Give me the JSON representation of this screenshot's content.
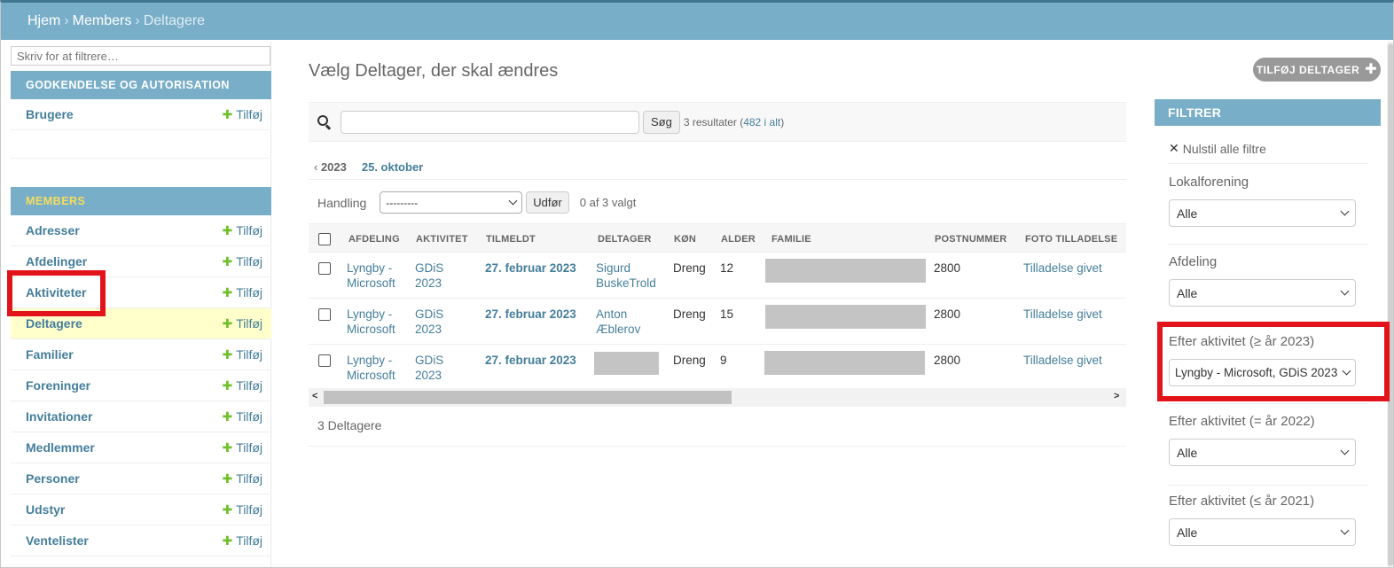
{
  "breadcrumb": {
    "home": "Hjem",
    "app": "Members",
    "current": "Deltagere",
    "separator": "›"
  },
  "sidebar": {
    "filter_placeholder": "Skriv for at filtrere…",
    "sections": [
      {
        "caption": "GODKENDELSE OG AUTORISATION",
        "items": [
          {
            "label": "Brugere",
            "add": "Tilføj"
          }
        ]
      },
      {
        "caption": "MEMBERS",
        "items": [
          {
            "label": "Adresser",
            "add": "Tilføj"
          },
          {
            "label": "Afdelinger",
            "add": "Tilføj"
          },
          {
            "label": "Aktiviteter",
            "add": "Tilføj"
          },
          {
            "label": "Deltagere",
            "add": "Tilføj",
            "selected": true
          },
          {
            "label": "Familier",
            "add": "Tilføj"
          },
          {
            "label": "Foreninger",
            "add": "Tilføj"
          },
          {
            "label": "Invitationer",
            "add": "Tilføj"
          },
          {
            "label": "Medlemmer",
            "add": "Tilføj"
          },
          {
            "label": "Personer",
            "add": "Tilføj"
          },
          {
            "label": "Udstyr",
            "add": "Tilføj"
          },
          {
            "label": "Ventelister",
            "add": "Tilføj"
          }
        ]
      }
    ]
  },
  "main": {
    "title": "Vælg Deltager, der skal ændres",
    "add_button": "TILFØJ DELTAGER",
    "search": {
      "button": "Søg",
      "result_prefix": "3 resultater (",
      "result_link": "482 i alt",
      "result_suffix": ")"
    },
    "date_nav": {
      "back_year": "2023",
      "day": "25. oktober"
    },
    "actions": {
      "label": "Handling",
      "select_value": "---------",
      "run": "Udfør",
      "selected_count": "0 af 3 valgt"
    },
    "columns": [
      "AFDELING",
      "AKTIVITET",
      "TILMELDT",
      "DELTAGER",
      "KØN",
      "ALDER",
      "FAMILIE",
      "POSTNUMMER",
      "FOTO TILLADELSE"
    ],
    "rows": [
      {
        "afdeling": [
          "Lyngby -",
          "Microsoft"
        ],
        "aktivitet": [
          "GDiS",
          "2023"
        ],
        "tilmeldt": "27. februar 2023",
        "deltager": [
          "Sigurd",
          "BuskeTrold"
        ],
        "koen": "Dreng",
        "alder": "12",
        "postnummer": "2800",
        "foto": "Tilladelse givet"
      },
      {
        "afdeling": [
          "Lyngby -",
          "Microsoft"
        ],
        "aktivitet": [
          "GDiS",
          "2023"
        ],
        "tilmeldt": "27. februar 2023",
        "deltager": [
          "Anton",
          "Æblerov"
        ],
        "koen": "Dreng",
        "alder": "15",
        "postnummer": "2800",
        "foto": "Tilladelse givet"
      },
      {
        "afdeling": [
          "Lyngby -",
          "Microsoft"
        ],
        "aktivitet": [
          "GDiS",
          "2023"
        ],
        "tilmeldt": "27. februar 2023",
        "deltager": [
          "",
          ""
        ],
        "koen": "Dreng",
        "alder": "9",
        "postnummer": "2800",
        "foto": "Tilladelse givet"
      }
    ],
    "paginator": "3 Deltagere"
  },
  "filters": {
    "caption": "FILTRER",
    "clear": "Nulstil alle filtre",
    "groups": [
      {
        "title": "Lokalforening",
        "value": "Alle"
      },
      {
        "title": "Afdeling",
        "value": "Alle"
      },
      {
        "title": "Efter aktivitet (≥ år 2023)",
        "value": "Lyngby - Microsoft, GDiS 2023"
      },
      {
        "title": "Efter aktivitet (= år 2022)",
        "value": "Alle"
      },
      {
        "title": "Efter aktivitet (≤ år 2021)",
        "value": "Alle"
      }
    ]
  },
  "colors": {
    "header": "#79aec8",
    "link": "#447e9b",
    "add_plus": "#70bf2b",
    "members_caption": "#f5dd5d",
    "highlight": "#e3131b",
    "selected_row": "#ffffcc"
  }
}
